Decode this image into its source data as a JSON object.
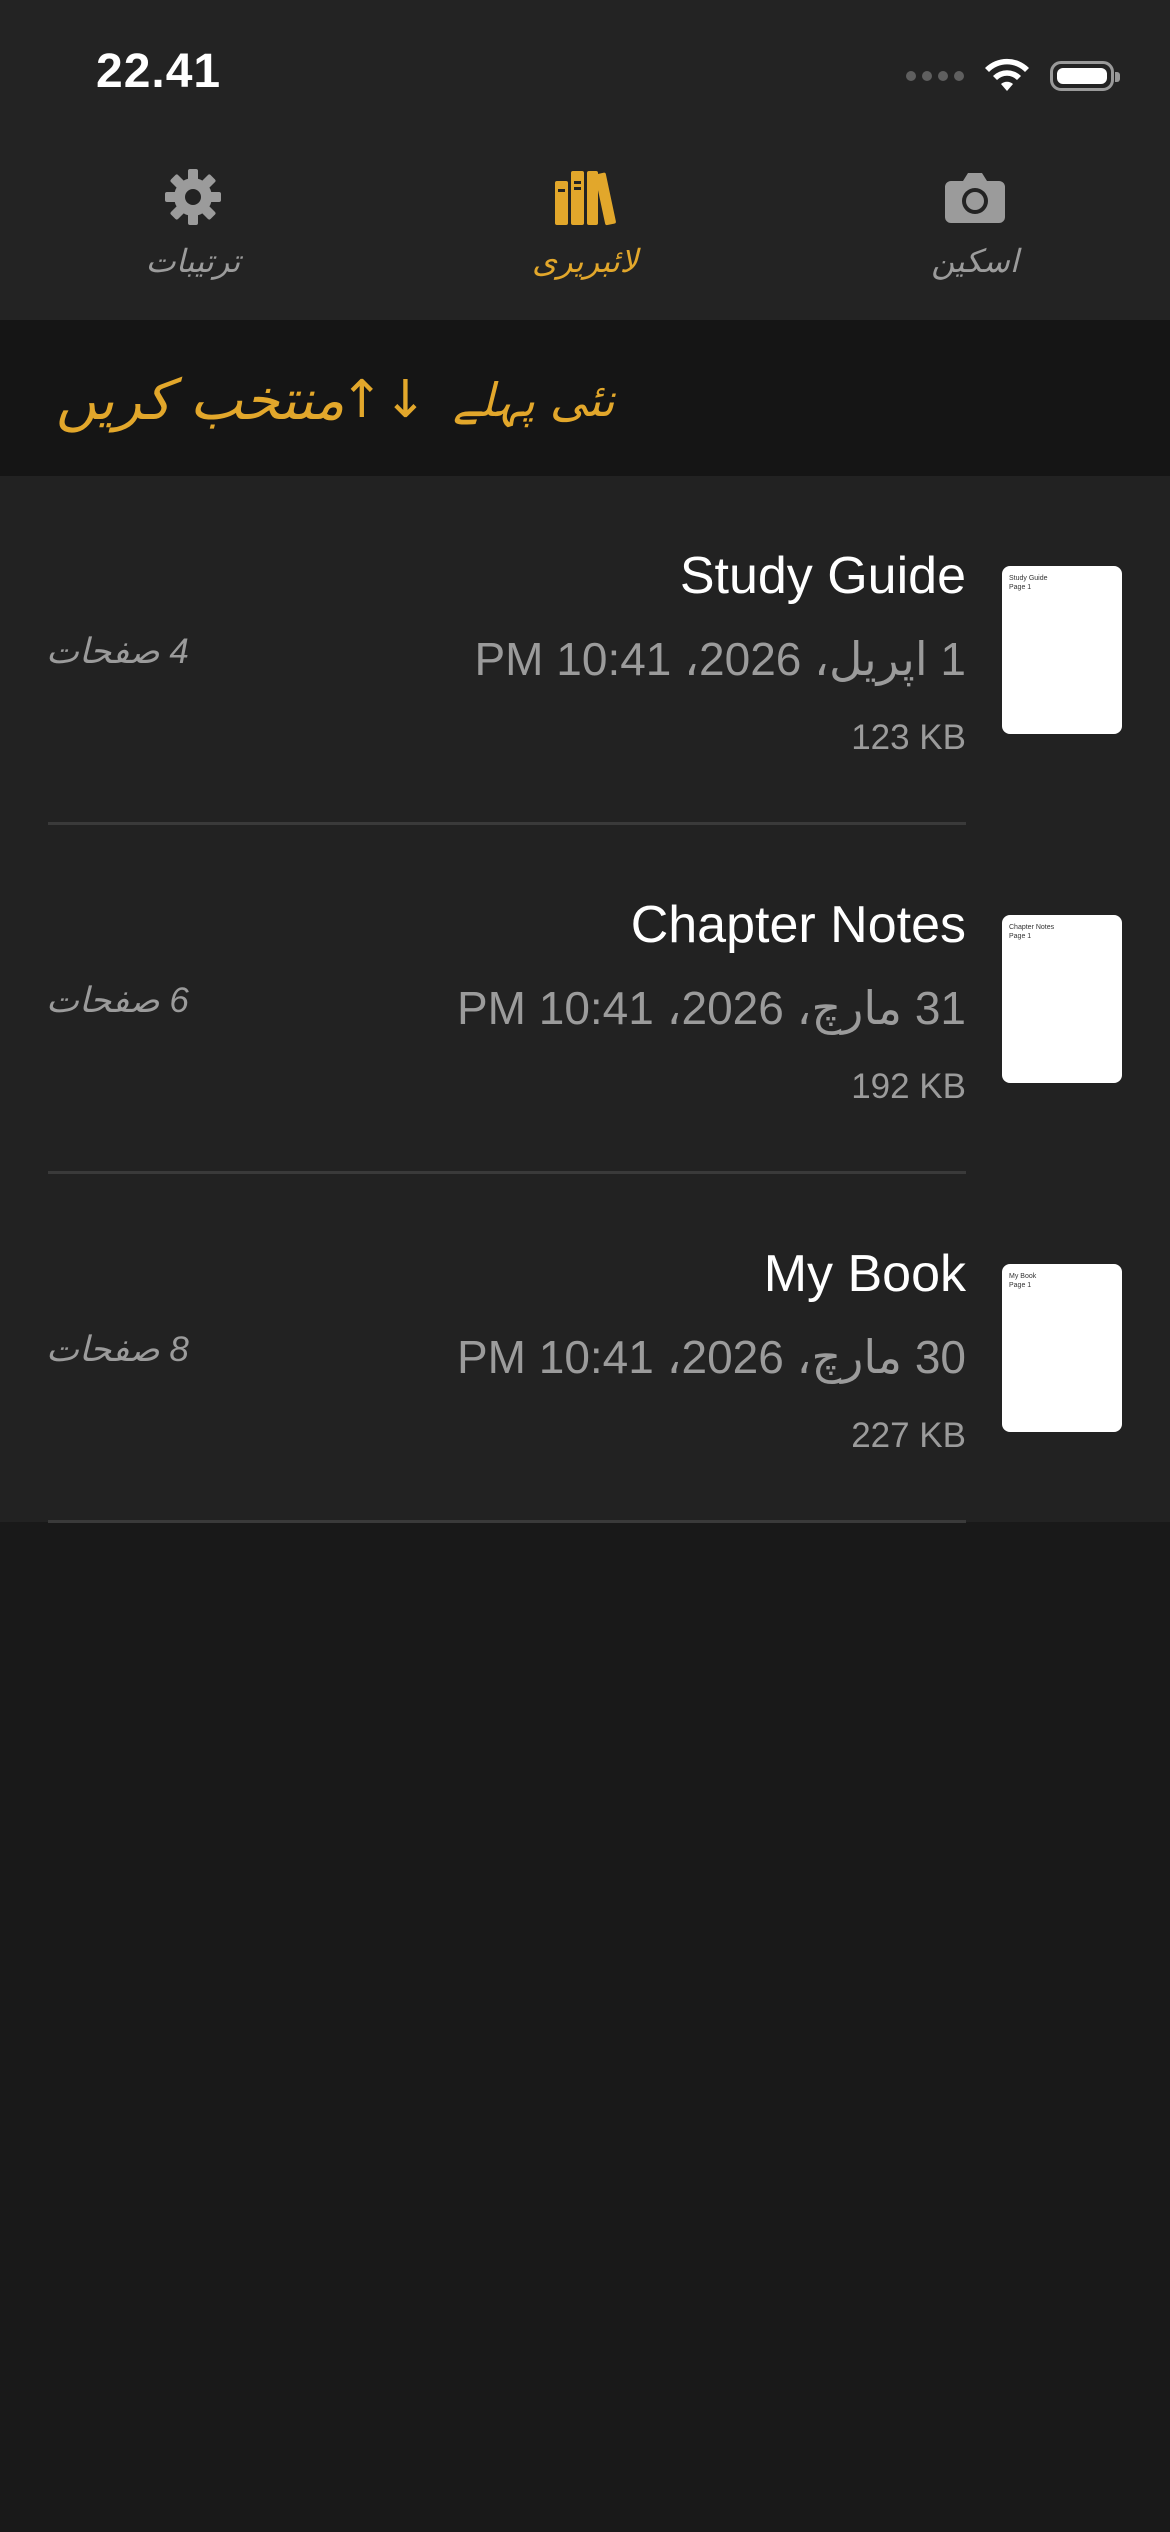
{
  "status_bar": {
    "time": "22.41"
  },
  "tabs": [
    {
      "id": "settings",
      "label": "ترتیبات",
      "icon": "gear-icon",
      "active": false
    },
    {
      "id": "library",
      "label": "لائبریری",
      "icon": "books-icon",
      "active": true
    },
    {
      "id": "scan",
      "label": "اسکین",
      "icon": "camera-icon",
      "active": false
    }
  ],
  "toolbar": {
    "select_label": "منتخب کریں",
    "sort_label": "نئی پہلے",
    "sort_icon": "↑↓"
  },
  "documents": [
    {
      "title": "Study Guide",
      "date": "1 اپریل، 2026، 10:41 PM",
      "size": "123 KB",
      "pages": "4 صفحات",
      "thumb_line1": "Study Guide",
      "thumb_line2": "Page 1"
    },
    {
      "title": "Chapter Notes",
      "date": "31 مارچ، 2026، 10:41 PM",
      "size": "192 KB",
      "pages": "6 صفحات",
      "thumb_line1": "Chapter Notes",
      "thumb_line2": "Page 1"
    },
    {
      "title": "My Book",
      "date": "30 مارچ، 2026، 10:41 PM",
      "size": "227 KB",
      "pages": "8 صفحات",
      "thumb_line1": "My Book",
      "thumb_line2": "Page 1"
    }
  ],
  "colors": {
    "accent": "#e2a72b",
    "background": "#191919",
    "list_background": "#222222",
    "secondary_text": "#9b9b9b"
  }
}
